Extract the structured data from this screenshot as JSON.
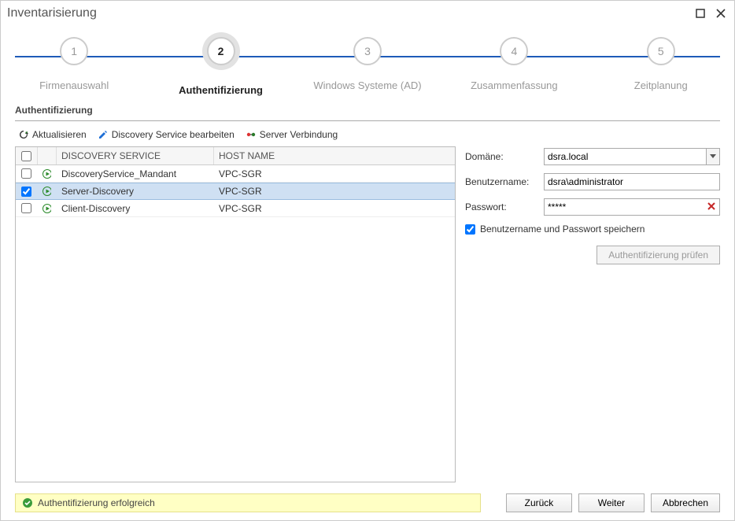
{
  "window": {
    "title": "Inventarisierung"
  },
  "steps": [
    {
      "num": "1",
      "label": "Firmenauswahl",
      "active": false
    },
    {
      "num": "2",
      "label": "Authentifizierung",
      "active": true
    },
    {
      "num": "3",
      "label": "Windows Systeme (AD)",
      "active": false
    },
    {
      "num": "4",
      "label": "Zusammenfassung",
      "active": false
    },
    {
      "num": "5",
      "label": "Zeitplanung",
      "active": false
    }
  ],
  "section_title": "Authentifizierung",
  "toolbar": {
    "refresh": "Aktualisieren",
    "edit": "Discovery Service bearbeiten",
    "conn": "Server Verbindung"
  },
  "grid": {
    "headers": {
      "service": "DISCOVERY SERVICE",
      "host": "HOST NAME"
    },
    "rows": [
      {
        "checked": false,
        "service": "DiscoveryService_Mandant",
        "host": "VPC-SGR",
        "selected": false
      },
      {
        "checked": true,
        "service": "Server-Discovery",
        "host": "VPC-SGR",
        "selected": true
      },
      {
        "checked": false,
        "service": "Client-Discovery",
        "host": "VPC-SGR",
        "selected": false
      }
    ]
  },
  "form": {
    "domain_label": "Domäne:",
    "domain_value": "dsra.local",
    "user_label": "Benutzername:",
    "user_value": "dsra\\administrator",
    "pass_label": "Passwort:",
    "pass_value": "*****",
    "save_creds_label": "Benutzername und Passwort speichern",
    "save_creds_checked": true,
    "verify_label": "Authentifizierung prüfen"
  },
  "status": {
    "text": "Authentifizierung erfolgreich"
  },
  "buttons": {
    "back": "Zurück",
    "next": "Weiter",
    "cancel": "Abbrechen"
  }
}
